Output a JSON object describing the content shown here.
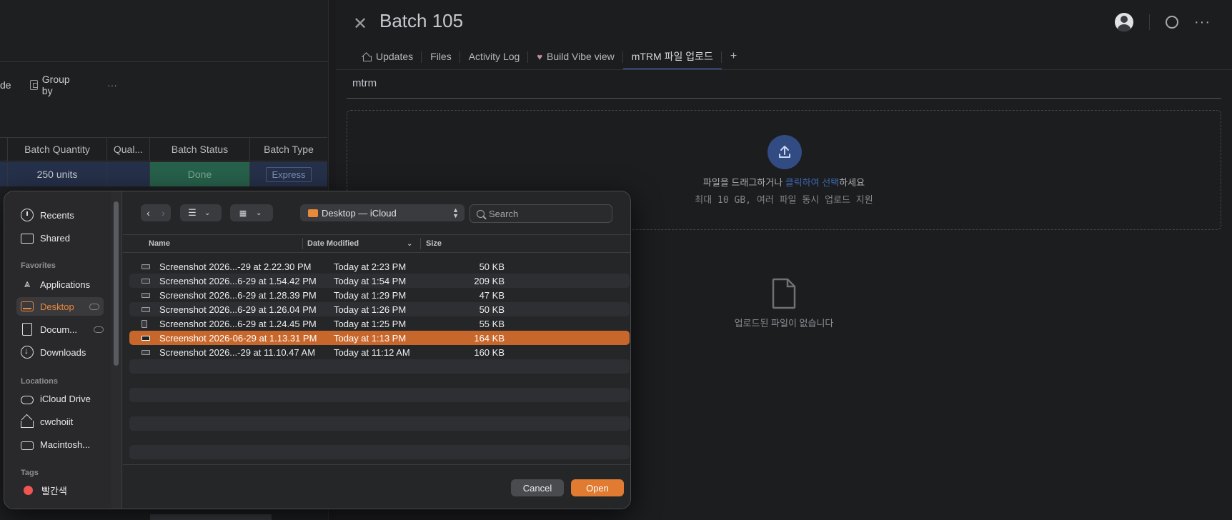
{
  "board": {
    "toolbar_hide": "de",
    "toolbar_group": "Group by",
    "toolbar_more": "···",
    "columns": [
      "Batch Quantity",
      "Qual...",
      "Batch Status",
      "Batch Type"
    ],
    "row1": {
      "quantity": "250 units",
      "qual": "",
      "status": "Done",
      "type": "Express"
    }
  },
  "panel": {
    "title": "Batch 105",
    "tabs": [
      {
        "label": "Updates"
      },
      {
        "label": "Files"
      },
      {
        "label": "Activity Log"
      },
      {
        "label": "Build Vibe view"
      },
      {
        "label": "mTRM 파일 업로드"
      }
    ],
    "add_tab": "+",
    "field_label": "mtrm",
    "dropzone": {
      "text_before": "파일을 드래그하거나 ",
      "link_click": "클릭하여",
      "text_mid": " ",
      "link_select": "선택",
      "text_after": "하세요",
      "limit": "최대 10 GB, 여러 파일 동시 업로드 지원"
    },
    "empty_message": "업로드된 파일이 없습니다",
    "colors": {
      "accent": "#4f7cd6",
      "upload_circle": "#324b82"
    }
  },
  "dialog": {
    "sidebar": {
      "top": [
        {
          "label": "Recents",
          "icon": "clock-icon"
        },
        {
          "label": "Shared",
          "icon": "shared-folder-icon"
        }
      ],
      "favorites_heading": "Favorites",
      "favorites": [
        {
          "label": "Applications",
          "icon": "applications-icon"
        },
        {
          "label": "Desktop",
          "icon": "desktop-icon"
        },
        {
          "label": "Docum...",
          "icon": "document-icon"
        },
        {
          "label": "Downloads",
          "icon": "downloads-icon"
        }
      ],
      "locations_heading": "Locations",
      "locations": [
        {
          "label": "iCloud Drive",
          "icon": "icloud-icon"
        },
        {
          "label": "cwchoiit",
          "icon": "home-icon"
        },
        {
          "label": "Macintosh...",
          "icon": "disk-icon"
        }
      ],
      "tags_heading": "Tags",
      "tags": [
        {
          "label": "빨간색",
          "color": "#f0554f"
        }
      ]
    },
    "location": "Desktop — iCloud",
    "search_placeholder": "Search",
    "columns": {
      "name": "Name",
      "date": "Date Modified",
      "size": "Size"
    },
    "files": [
      {
        "name": "Screenshot 2026...-29 at 2.22.30 PM",
        "date": "Today at 2:23 PM",
        "size": "50 KB"
      },
      {
        "name": "Screenshot 2026...6-29 at 1.54.42 PM",
        "date": "Today at 1:54 PM",
        "size": "209 KB"
      },
      {
        "name": "Screenshot 2026...6-29 at 1.28.39 PM",
        "date": "Today at 1:29 PM",
        "size": "47 KB"
      },
      {
        "name": "Screenshot 2026...6-29 at 1.26.04 PM",
        "date": "Today at 1:26 PM",
        "size": "50 KB"
      },
      {
        "name": "Screenshot 2026...6-29 at 1.24.45 PM",
        "date": "Today at 1:25 PM",
        "size": "55 KB"
      },
      {
        "name": "Screenshot 2026-06-29 at 1.13.31 PM",
        "date": "Today at 1:13 PM",
        "size": "164 KB"
      },
      {
        "name": "Screenshot 2026...-29 at 11.10.47 AM",
        "date": "Today at 11:12 AM",
        "size": "160 KB"
      }
    ],
    "selected_index": 5,
    "cancel_label": "Cancel",
    "open_label": "Open",
    "colors": {
      "selection": "#c8672b",
      "open_button": "#e07b31"
    }
  }
}
